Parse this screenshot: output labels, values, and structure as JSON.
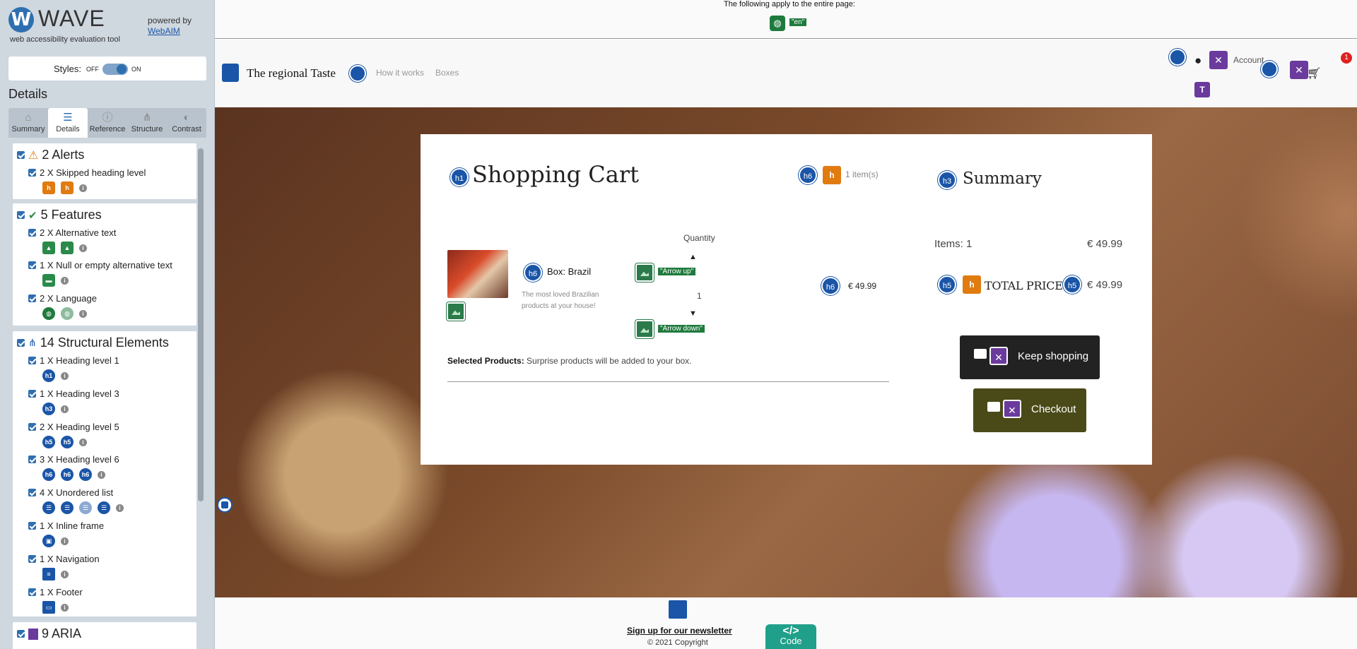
{
  "wave": {
    "logo": "W",
    "name": "WAVE",
    "tagline": "web accessibility evaluation tool",
    "powered_by": "powered by",
    "webaim": "WebAIM",
    "styles_label": "Styles:",
    "styles_off": "OFF",
    "styles_on": "ON",
    "details_heading": "Details",
    "tabs": [
      {
        "label": "Summary",
        "icon": "home-icon"
      },
      {
        "label": "Details",
        "icon": "list-icon"
      },
      {
        "label": "Reference",
        "icon": "info-icon"
      },
      {
        "label": "Structure",
        "icon": "structure-icon"
      },
      {
        "label": "Contrast",
        "icon": "contrast-icon"
      }
    ],
    "groups": {
      "alerts": {
        "title": "2 Alerts",
        "items": [
          {
            "label": "2 X Skipped heading level"
          }
        ]
      },
      "features": {
        "title": "5 Features",
        "items": [
          {
            "label": "2 X Alternative text"
          },
          {
            "label": "1 X Null or empty alternative text"
          },
          {
            "label": "2 X Language"
          }
        ]
      },
      "structure": {
        "title": "14 Structural Elements",
        "items": [
          {
            "label": "1 X Heading level 1"
          },
          {
            "label": "1 X Heading level 3"
          },
          {
            "label": "2 X Heading level 5"
          },
          {
            "label": "3 X Heading level 6"
          },
          {
            "label": "4 X Unordered list"
          },
          {
            "label": "1 X Inline frame"
          },
          {
            "label": "1 X Navigation"
          },
          {
            "label": "1 X Footer"
          }
        ]
      },
      "aria": {
        "title": "9 ARIA"
      }
    },
    "icon_labels": {
      "h1": "h1",
      "h3": "h3",
      "h5": "h5",
      "h6": "h6"
    }
  },
  "page": {
    "apply_text": "The following apply to the entire page:",
    "lang_value": "\"en\"",
    "brand": "The regional Taste",
    "nav": [
      "How it works",
      "Boxes"
    ],
    "account": "Account",
    "cart_count": "1",
    "cart": {
      "title": "Shopping Cart",
      "item_count": "1 item(s)",
      "product_name": "Box: Brazil",
      "product_desc": "The most loved Brazilian products at your house!",
      "quantity_label": "Quantity",
      "arrow_up_alt": "\"Arrow up\"",
      "quantity_value": "1",
      "arrow_down_alt": "\"Arrow down\"",
      "price": "€ 49.99",
      "selected_label": "Selected Products:",
      "selected_text": " Surprise products will be added to your box."
    },
    "summary": {
      "title": "Summary",
      "items_label": "Items: 1",
      "items_value": "€ 49.99",
      "total_label": "TOTAL PRICE",
      "total_value": "€ 49.99",
      "keep_shopping": "Keep shopping",
      "checkout": "Checkout"
    },
    "footer": {
      "newsletter": "Sign up for our newsletter",
      "copyright": "© 2021 Copyright",
      "code_label": "Code",
      "code_glyph": "</>"
    }
  }
}
